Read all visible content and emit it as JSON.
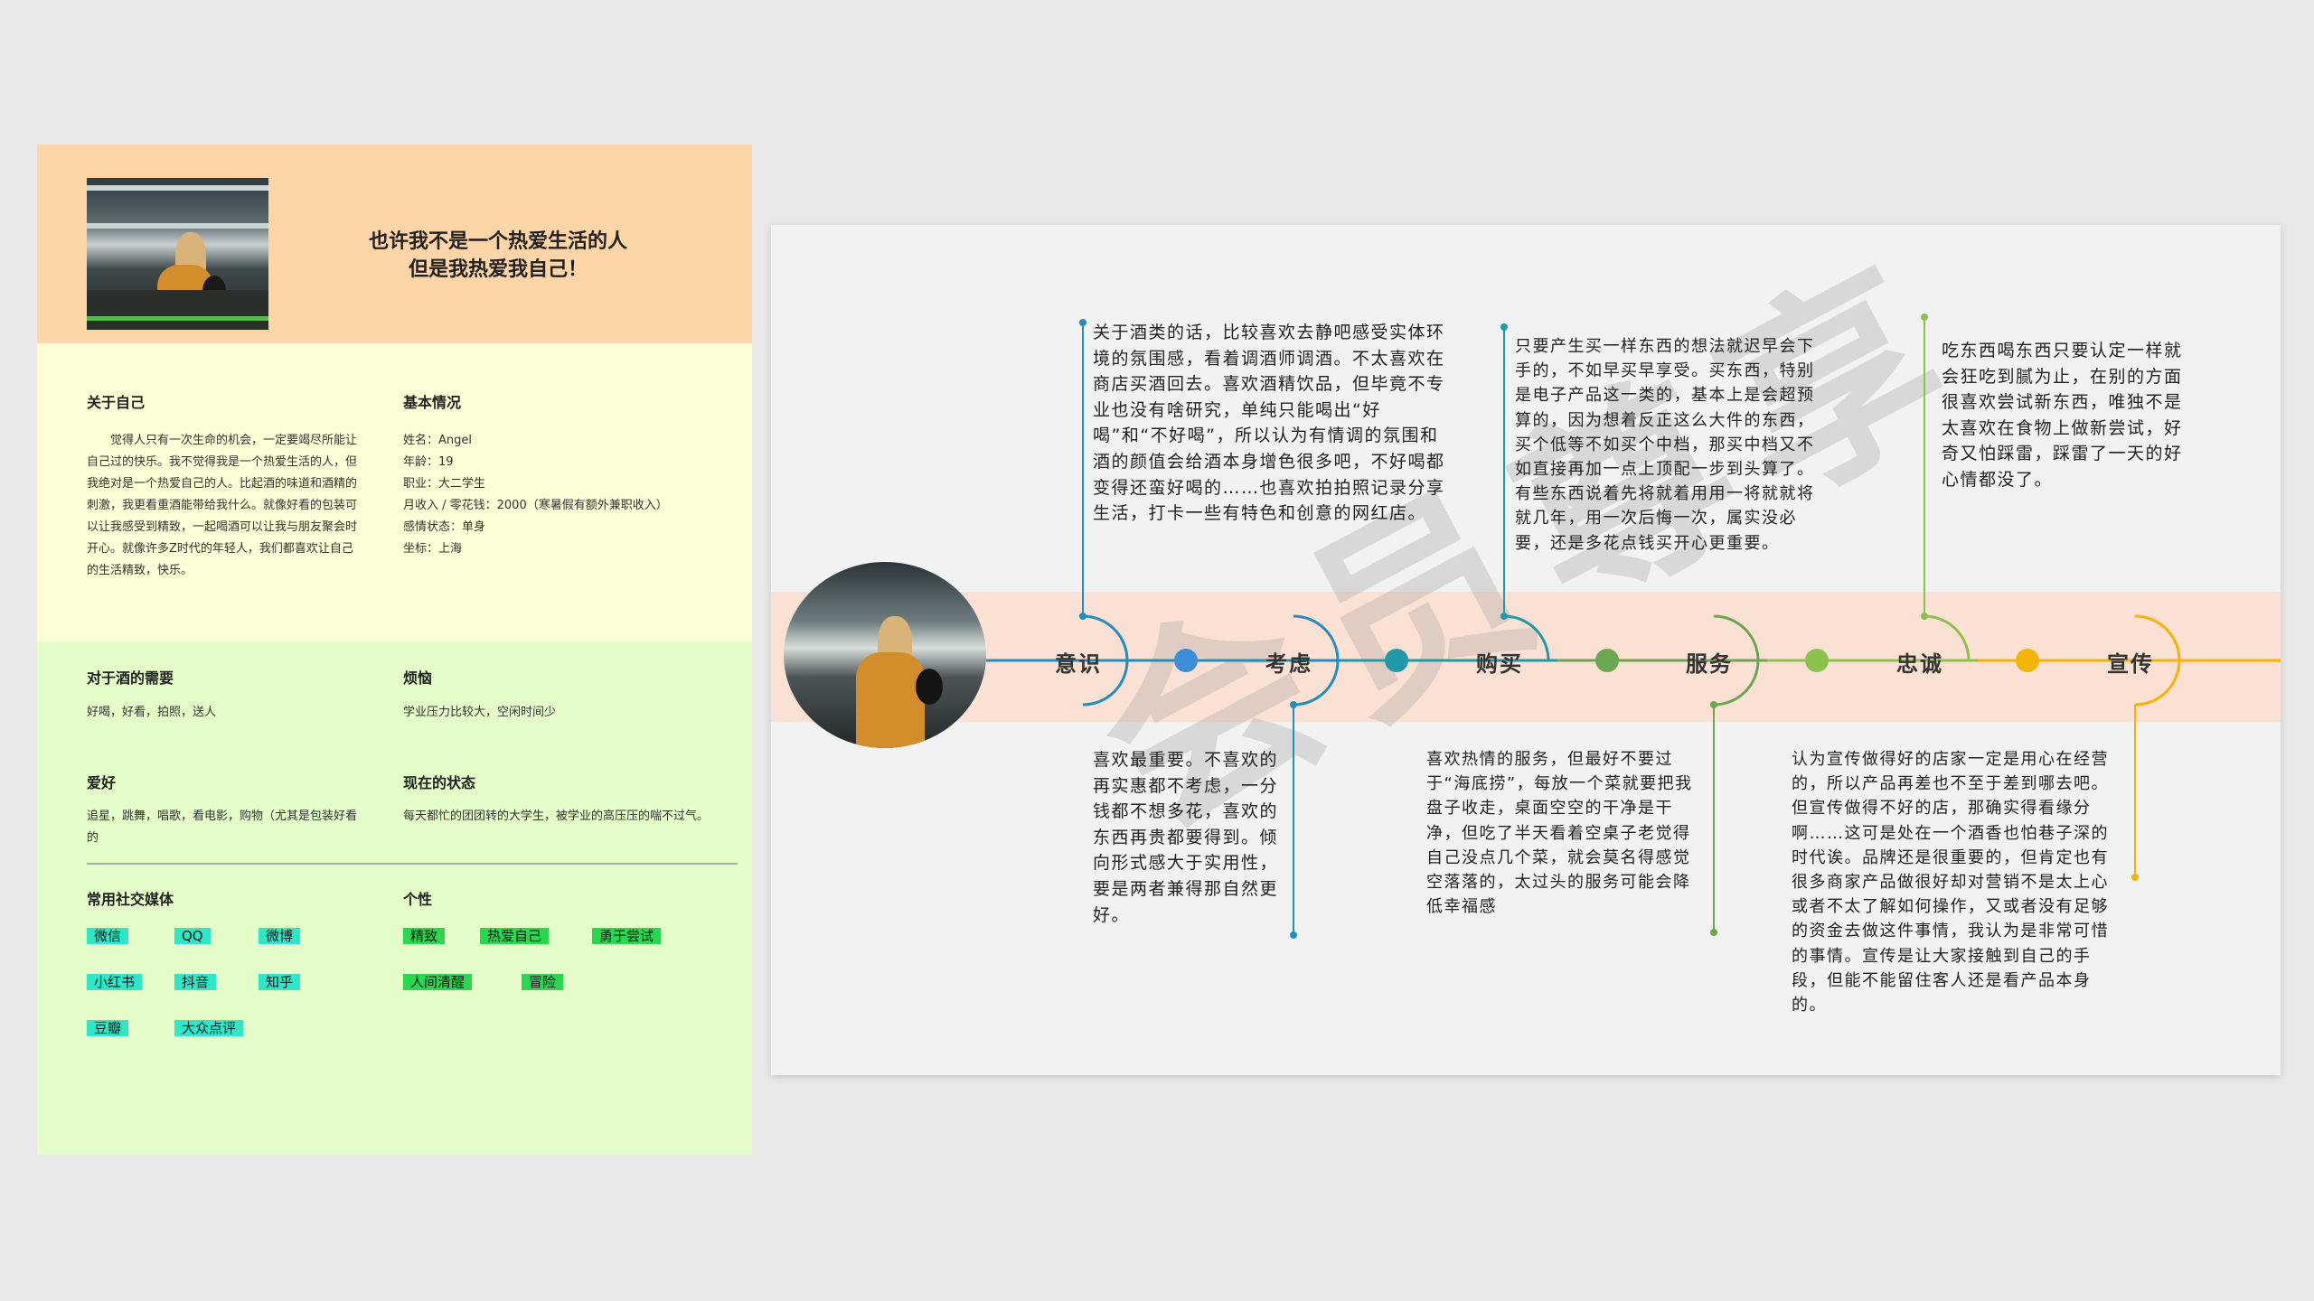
{
  "persona": {
    "headline": [
      "也许我不是一个热爱生活的人",
      "但是我热爱我自己！"
    ],
    "about": {
      "title": "关于自己",
      "text": "觉得人只有一次生命的机会，一定要竭尽所能让自己过的快乐。我不觉得我是一个热爱生活的人，但我绝对是一个热爱自己的人。比起酒的味道和酒精的刺激，我更看重酒能带给我什么。就像好看的包装可以让我感受到精致，一起喝酒可以让我与朋友聚会时开心。就像许多Z时代的年轻人，我们都喜欢让自己的生活精致，快乐。"
    },
    "basic": {
      "title": "基本情况",
      "rows": [
        "姓名：Angel",
        "年龄：19",
        "职业：大二学生",
        "月收入 / 零花钱：2000（寒暑假有额外兼职收入）",
        "感情状态：单身",
        "坐标：上海"
      ]
    },
    "needs": {
      "title": "对于酒的需要",
      "text": "好喝，好看，拍照，送人"
    },
    "worries": {
      "title": "烦恼",
      "text": "学业压力比较大，空闲时间少"
    },
    "hobbies": {
      "title": "爱好",
      "text": "追星，跳舞，唱歌，看电影，购物（尤其是包装好看的"
    },
    "status": {
      "title": "现在的状态",
      "text": "每天都忙的团团转的大学生，被学业的高压压的喘不过气。"
    },
    "media": {
      "title": "常用社交媒体",
      "tags": [
        "微信",
        "QQ",
        "微博",
        "小红书",
        "抖音",
        "知乎",
        "豆瓣",
        "大众点评"
      ]
    },
    "traits": {
      "title": "个性",
      "tags": [
        "精致",
        "热爱自己",
        "勇于尝试",
        "人间清醒",
        "冒险"
      ]
    },
    "colors": {
      "header": "#fdd5a6",
      "about": "#fefed6",
      "needs": "#e4fdc8",
      "media_tag": "#2de8c8",
      "trait_tag": "#2ad84f"
    }
  },
  "journey": {
    "watermark": "会员尊享",
    "stages": [
      {
        "label": "意识",
        "color": "#1f8fbf"
      },
      {
        "label": "考虑",
        "color": "#1f8fbf"
      },
      {
        "label": "购买",
        "color": "#1f9aa8"
      },
      {
        "label": "服务",
        "color": "#6aa84f"
      },
      {
        "label": "忠诚",
        "color": "#8bc34a"
      },
      {
        "label": "宣传",
        "color": "#f4b400"
      }
    ],
    "texts": {
      "awareness": "关于酒类的话，比较喜欢去静吧感受实体环境的氛围感，看着调酒师调酒。不太喜欢在商店买酒回去。喜欢酒精饮品，但毕竟不专业也没有啥研究，单纯只能喝出“好喝”和“不好喝”，所以认为有情调的氛围和酒的颜值会给酒本身增色很多吧，不好喝都变得还蛮好喝的……也喜欢拍拍照记录分享生活，打卡一些有特色和创意的网红店。",
      "consider": "喜欢最重要。不喜欢的再实惠都不考虑，一分钱都不想多花，喜欢的东西再贵都要得到。倾向形式感大于实用性，要是两者兼得那自然更好。",
      "purchase": "只要产生买一样东西的想法就迟早会下手的，不如早买早享受。买东西，特别是电子产品这一类的，基本上是会超预算的，因为想着反正这么大件的东西，买个低等不如买个中档，那买中档又不如直接再加一点上顶配一步到头算了。有些东西说着先将就着用用一将就就将就几年，用一次后悔一次，属实没必要，还是多花点钱买开心更重要。",
      "service": "喜欢热情的服务，但最好不要过于“海底捞”，每放一个菜就要把我盘子收走，桌面空空的干净是干净，但吃了半天看着空桌子老觉得自己没点几个菜，就会莫名得感觉空落落的，太过头的服务可能会降低幸福感",
      "loyalty": "吃东西喝东西只要认定一样就会狂吃到腻为止，在别的方面很喜欢尝试新东西，唯独不是太喜欢在食物上做新尝试，好奇又怕踩雷，踩雷了一天的好心情都没了。",
      "advocacy": "认为宣传做得好的店家一定是用心在经营的，所以产品再差也不至于差到哪去吧。但宣传做得不好的店，那确实得看缘分啊……这可是处在一个酒香也怕巷子深的时代诶。品牌还是很重要的，但肯定也有很多商家产品做很好却对营销不是太上心或者不太了解如何操作，又或者没有足够的资金去做这件事情，我认为是非常可惜的事情。宣传是让大家接触到自己的手段，但能不能留住客人还是看产品本身的。"
    },
    "colors": {
      "band": "#fbe1d3",
      "panel": "#f2f2f2",
      "c1": "#1f8fbf",
      "c2": "#1f9aa8",
      "c3": "#6aa84f",
      "c4": "#8bc34a",
      "c5": "#f4b400",
      "dot1": "#3a8fd8",
      "dot2": "#1f9aa8",
      "dot3": "#6aa84f",
      "dot4": "#8bc34a",
      "dot5": "#f4b400"
    }
  }
}
